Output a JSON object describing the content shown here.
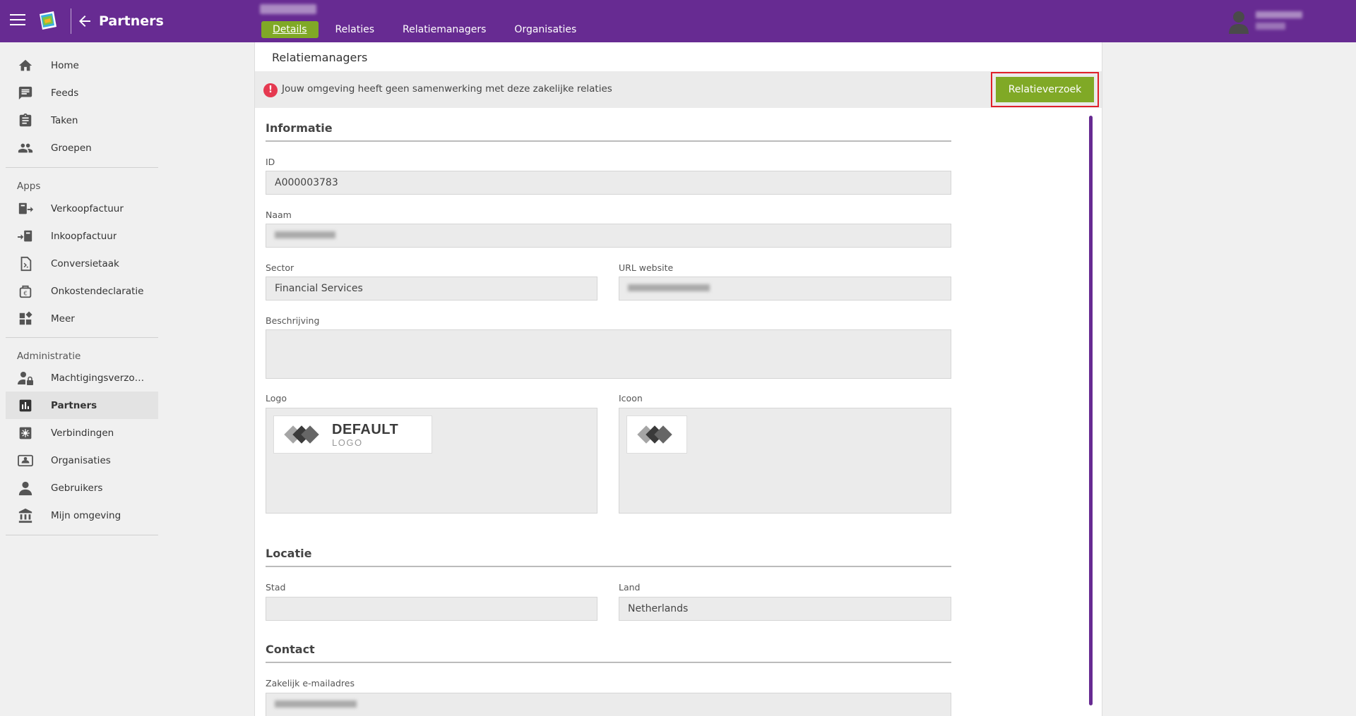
{
  "header": {
    "title": "Partners",
    "tabs": [
      {
        "label": "Details",
        "active": true
      },
      {
        "label": "Relaties",
        "active": false
      },
      {
        "label": "Relatiemanagers",
        "active": false
      },
      {
        "label": "Organisaties",
        "active": false
      }
    ],
    "accent_color": "#672b92",
    "active_tab_color": "#80a926"
  },
  "sidebar": {
    "main_items": [
      {
        "label": "Home",
        "icon": "home-icon"
      },
      {
        "label": "Feeds",
        "icon": "feeds-icon"
      },
      {
        "label": "Taken",
        "icon": "tasks-icon"
      },
      {
        "label": "Groepen",
        "icon": "groups-icon"
      }
    ],
    "apps_label": "Apps",
    "apps_items": [
      {
        "label": "Verkoopfactuur",
        "icon": "sales-invoice-icon"
      },
      {
        "label": "Inkoopfactuur",
        "icon": "purchase-invoice-icon"
      },
      {
        "label": "Conversietaak",
        "icon": "conversion-task-icon"
      },
      {
        "label": "Onkostendeclaratie",
        "icon": "expense-claim-icon"
      },
      {
        "label": "Meer",
        "icon": "more-apps-icon"
      }
    ],
    "admin_label": "Administratie",
    "admin_items": [
      {
        "label": "Machtigingsverzoek...",
        "icon": "authorization-request-icon"
      },
      {
        "label": "Partners",
        "icon": "partners-icon",
        "active": true
      },
      {
        "label": "Verbindingen",
        "icon": "connections-icon"
      },
      {
        "label": "Organisaties",
        "icon": "organizations-icon"
      },
      {
        "label": "Gebruikers",
        "icon": "users-icon"
      },
      {
        "label": "Mijn omgeving",
        "icon": "my-environment-icon"
      }
    ]
  },
  "main": {
    "panel_title": "Relatiemanagers",
    "alert": {
      "text": "Jouw omgeving heeft geen samenwerking met deze zakelijke relaties",
      "icon": "alert-icon",
      "button_label": "Relatieverzoek"
    },
    "sections": {
      "informatie": "Informatie",
      "locatie": "Locatie",
      "contact": "Contact"
    },
    "fields": {
      "id_label": "ID",
      "id_value": "A000003783",
      "naam_label": "Naam",
      "sector_label": "Sector",
      "sector_value": "Financial Services",
      "url_label": "URL website",
      "beschrijving_label": "Beschrijving",
      "logo_label": "Logo",
      "icoon_label": "Icoon",
      "stad_label": "Stad",
      "land_label": "Land",
      "land_value": "Netherlands",
      "email_label": "Zakelijk e-mailadres"
    },
    "default_logo": {
      "main": "DEFAULT",
      "sub": "LOGO"
    }
  }
}
